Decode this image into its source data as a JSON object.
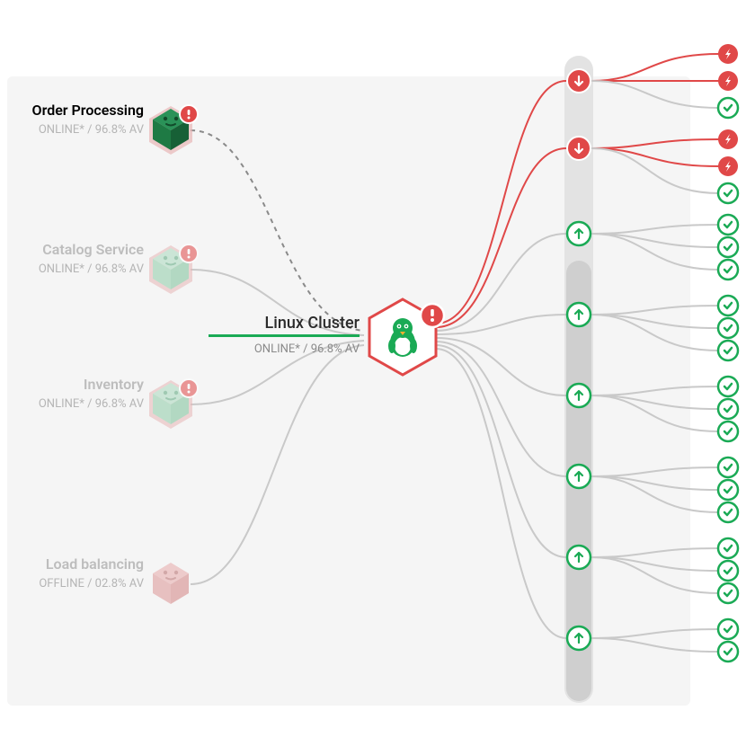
{
  "services": [
    {
      "name": "Order Processing",
      "status_line": "ONLINE* / 96.8% AV",
      "emphasis": true,
      "color": "dark-green",
      "badge": "alert-red"
    },
    {
      "name": "Catalog Service",
      "status_line": "ONLINE* / 96.8% AV",
      "emphasis": false,
      "color": "light-green",
      "badge": "alert-red"
    },
    {
      "name": "Inventory",
      "status_line": "ONLINE* / 96.8% AV",
      "emphasis": false,
      "color": "light-green",
      "badge": "alert-red"
    },
    {
      "name": "Load balancing",
      "status_line": "OFFLINE / 02.8% AV",
      "emphasis": false,
      "color": "light-red",
      "badge": "none"
    }
  ],
  "center": {
    "title": "Linux Cluster",
    "status_line": "ONLINE* / 96.8% AV",
    "badge": "alert-red",
    "icon": "penguin"
  },
  "column_nodes": [
    {
      "status": "down"
    },
    {
      "status": "down"
    },
    {
      "status": "up"
    },
    {
      "status": "up"
    },
    {
      "status": "up"
    },
    {
      "status": "up"
    },
    {
      "status": "up"
    },
    {
      "status": "up"
    }
  ],
  "leaves": [
    [
      {
        "status": "error"
      },
      {
        "status": "error"
      },
      {
        "status": "ok"
      }
    ],
    [
      {
        "status": "error"
      },
      {
        "status": "error"
      },
      {
        "status": "ok"
      }
    ],
    [
      {
        "status": "ok"
      },
      {
        "status": "ok"
      },
      {
        "status": "ok"
      }
    ],
    [
      {
        "status": "ok"
      },
      {
        "status": "ok"
      },
      {
        "status": "ok"
      }
    ],
    [
      {
        "status": "ok"
      },
      {
        "status": "ok"
      },
      {
        "status": "ok"
      }
    ],
    [
      {
        "status": "ok"
      },
      {
        "status": "ok"
      },
      {
        "status": "ok"
      }
    ],
    [
      {
        "status": "ok"
      },
      {
        "status": "ok"
      },
      {
        "status": "ok"
      }
    ],
    [
      {
        "status": "ok"
      },
      {
        "status": "ok"
      }
    ]
  ],
  "colors": {
    "red": "#e04848",
    "green": "#1aaa55",
    "dark_green": "#1e7a44",
    "light_green_fill": "#a9d9bd",
    "light_red_fill": "#e7a9a9",
    "panel_bg": "#f5f5f5",
    "column_bg": "#e3e3e3",
    "scroll": "#cfcfcf",
    "wire_grey": "#c9c9c9"
  },
  "layout_note": "Network/topology diagram: 4 service cubes on left → central Linux Cluster hexagon → vertical column of 8 node circles → fan-out to leaf status dots on right."
}
